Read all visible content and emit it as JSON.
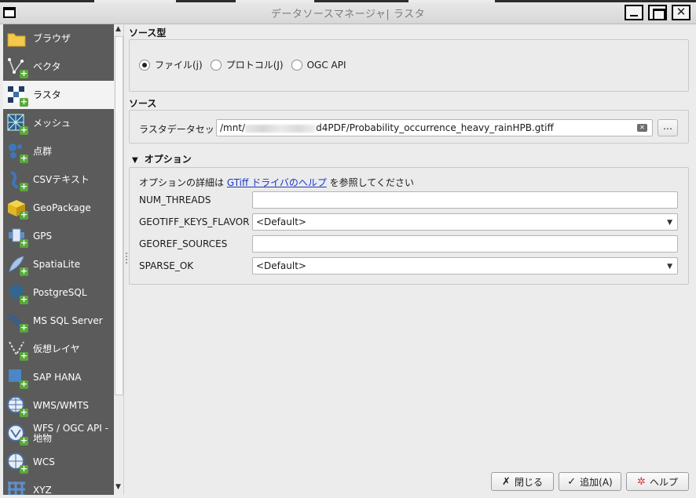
{
  "window": {
    "title": "データソースマネージャ| ラスタ"
  },
  "sidebar": {
    "items": [
      {
        "label": "ブラウザ",
        "icon": "folder-icon"
      },
      {
        "label": "ベクタ",
        "icon": "vector-icon"
      },
      {
        "label": "ラスタ",
        "icon": "raster-icon",
        "active": true
      },
      {
        "label": "メッシュ",
        "icon": "mesh-icon"
      },
      {
        "label": "点群",
        "icon": "point-cloud-icon"
      },
      {
        "label": "CSVテキスト",
        "icon": "csv-icon"
      },
      {
        "label": "GeoPackage",
        "icon": "geopackage-icon"
      },
      {
        "label": "GPS",
        "icon": "gps-icon"
      },
      {
        "label": "SpatiaLite",
        "icon": "spatialite-icon"
      },
      {
        "label": "PostgreSQL",
        "icon": "postgresql-icon"
      },
      {
        "label": "MS SQL Server",
        "icon": "mssql-icon"
      },
      {
        "label": "仮想レイヤ",
        "icon": "virtual-layer-icon"
      },
      {
        "label": "SAP HANA",
        "icon": "sap-hana-icon"
      },
      {
        "label": "WMS/WMTS",
        "icon": "wms-icon"
      },
      {
        "label": "WFS / OGC API - 地物",
        "icon": "wfs-icon"
      },
      {
        "label": "WCS",
        "icon": "wcs-icon"
      },
      {
        "label": "XYZ",
        "icon": "xyz-icon"
      }
    ]
  },
  "source_type": {
    "title": "ソース型",
    "options": [
      "ファイル(j)",
      "プロトコル(J)",
      "OGC API"
    ],
    "selected": 0
  },
  "source": {
    "title": "ソース",
    "dataset_label": "ラスタデータセット",
    "path_prefix": "/mnt/",
    "path_suffix": "d4PDF/Probability_occurrence_heavy_rainHPB.gtiff",
    "browse_label": "…"
  },
  "options": {
    "title": "オプション",
    "help_prefix": "オプションの詳細は ",
    "help_link": "GTiff ドライバのヘルプ",
    "help_suffix": " を参照してください",
    "rows": [
      {
        "label": "NUM_THREADS",
        "type": "text",
        "value": ""
      },
      {
        "label": "GEOTIFF_KEYS_FLAVOR",
        "type": "combo",
        "value": "<Default>"
      },
      {
        "label": "GEOREF_SOURCES",
        "type": "text",
        "value": ""
      },
      {
        "label": "SPARSE_OK",
        "type": "combo",
        "value": "<Default>"
      }
    ]
  },
  "buttons": {
    "close": "閉じる",
    "add": "追加(A)",
    "help": "ヘルプ"
  }
}
